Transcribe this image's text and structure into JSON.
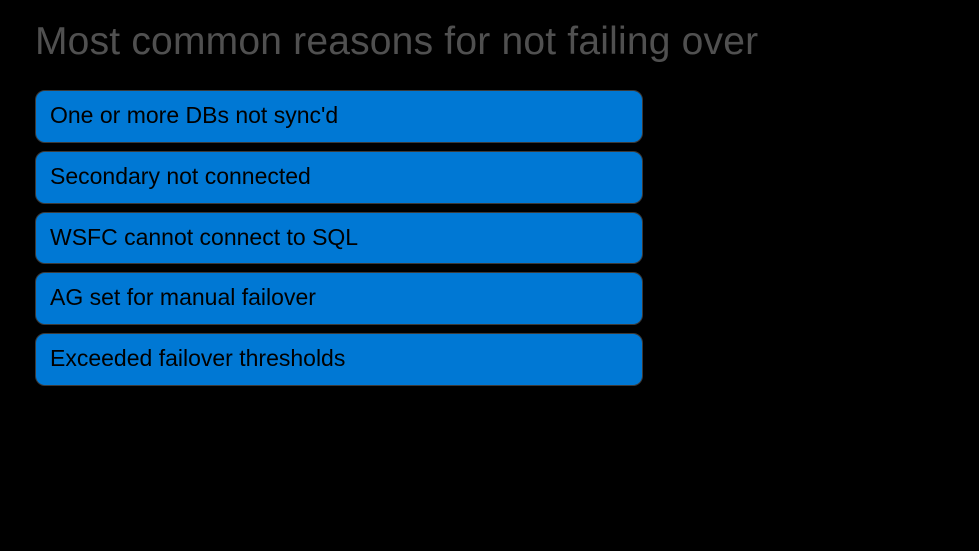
{
  "slide": {
    "title": "Most common reasons for not failing over",
    "reasons": [
      "One or more DBs not sync'd",
      "Secondary not connected",
      "WSFC cannot connect to SQL",
      "AG set for manual failover",
      "Exceeded failover thresholds"
    ]
  }
}
